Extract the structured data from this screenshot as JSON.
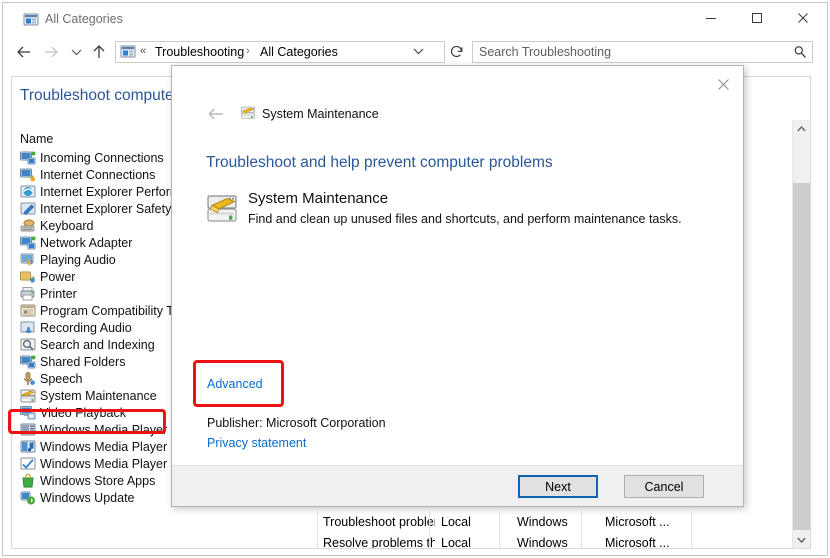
{
  "window": {
    "title": "All Categories",
    "title_icon": "troubleshooting-icon",
    "minimize_label": "─",
    "maximize_label": "□",
    "close_label": "✕"
  },
  "navbar": {
    "back_label": "←",
    "forward_label": "→",
    "recent_label": "⌄",
    "up_label": "↑",
    "address": {
      "icon": "troubleshooting-icon",
      "chevrons": "«",
      "crumb1": "Troubleshooting",
      "separator": "›",
      "crumb2": "All Categories",
      "dropdown": "⌄"
    },
    "refresh_label": "↻",
    "search": {
      "placeholder": "Search Troubleshooting",
      "icon": "search-icon"
    }
  },
  "pane": {
    "heading": "Troubleshoot computer problems",
    "column_header": "Name",
    "items": [
      {
        "label": "Incoming Connections",
        "icon": "network-incoming-icon"
      },
      {
        "label": "Internet Connections",
        "icon": "network-internet-icon"
      },
      {
        "label": "Internet Explorer Performance",
        "icon": "ie-performance-icon"
      },
      {
        "label": "Internet Explorer Safety",
        "icon": "ie-safety-icon"
      },
      {
        "label": "Keyboard",
        "icon": "keyboard-icon"
      },
      {
        "label": "Network Adapter",
        "icon": "network-adapter-icon"
      },
      {
        "label": "Playing Audio",
        "icon": "playing-audio-icon"
      },
      {
        "label": "Power",
        "icon": "power-icon"
      },
      {
        "label": "Printer",
        "icon": "printer-icon"
      },
      {
        "label": "Program Compatibility Troubleshooter",
        "icon": "program-compatibility-icon"
      },
      {
        "label": "Recording Audio",
        "icon": "recording-audio-icon"
      },
      {
        "label": "Search and Indexing",
        "icon": "search-indexing-icon"
      },
      {
        "label": "Shared Folders",
        "icon": "shared-folders-icon"
      },
      {
        "label": "Speech",
        "icon": "speech-icon"
      },
      {
        "label": "System Maintenance",
        "icon": "system-maintenance-icon"
      },
      {
        "label": "Video Playback",
        "icon": "video-playback-icon"
      },
      {
        "label": "Windows Media Player DVD",
        "icon": "wmp-dvd-icon"
      },
      {
        "label": "Windows Media Player Library",
        "icon": "wmp-library-icon"
      },
      {
        "label": "Windows Media Player Settings",
        "icon": "wmp-settings-icon"
      },
      {
        "label": "Windows Store Apps",
        "icon": "store-apps-icon"
      },
      {
        "label": "Windows Update",
        "icon": "windows-update-icon"
      }
    ],
    "scrollbar": {
      "up_label": "⌃",
      "down_label": "⌄"
    }
  },
  "background_table": {
    "rows": [
      {
        "description": "Troubleshoot problems that may ...",
        "location": "Local",
        "category": "Windows",
        "publisher": "Microsoft ..."
      },
      {
        "description": "Resolve problems that prevent yo...",
        "location": "Local",
        "category": "Windows",
        "publisher": "Microsoft ..."
      }
    ]
  },
  "dialog": {
    "close_label": "✕",
    "back_label": "←",
    "header_icon": "system-maintenance-icon",
    "header_title": "System Maintenance",
    "heading": "Troubleshoot and help prevent computer problems",
    "item_icon": "system-maintenance-icon",
    "item_title": "System Maintenance",
    "item_description": "Find and clean up unused files and shortcuts, and perform maintenance tasks.",
    "advanced_link": "Advanced",
    "publisher_line": "Publisher:  Microsoft Corporation",
    "privacy_link": "Privacy statement",
    "next_button": "Next",
    "cancel_button": "Cancel"
  },
  "annotations": {
    "highlight_color": "#ee1111",
    "accent_blue": "#2b5797",
    "link_blue": "#0a6bd0",
    "focus_blue": "#1063b0"
  }
}
